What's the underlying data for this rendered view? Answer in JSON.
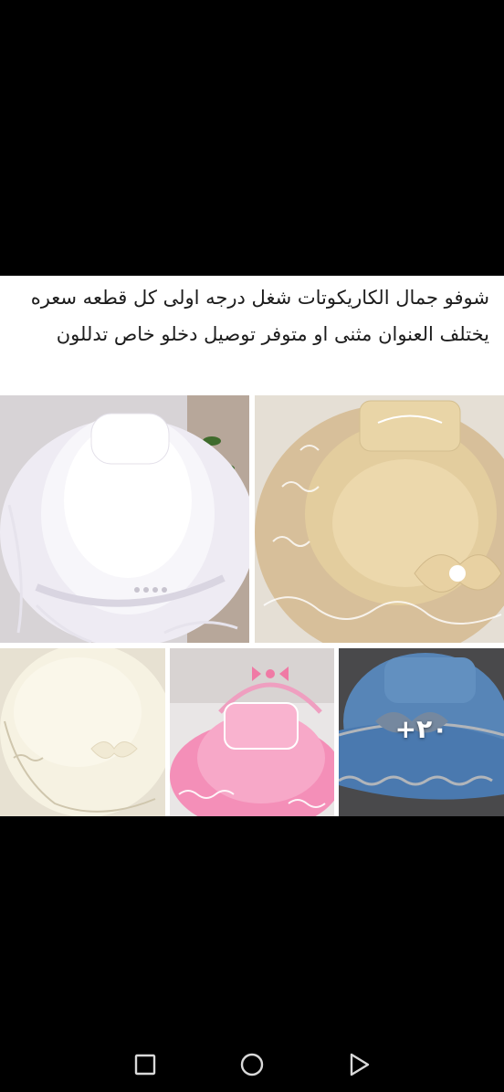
{
  "post": {
    "caption": "شوفو جمال الكاريكوتات شغل درجه اولى كل قطعه سعره يختلف العنوان مثنى او متوفر توصيل دخلو خاص تدللون",
    "more_photos_label": "+٢٠"
  },
  "photos": [
    {
      "icon": "white-baby-nest-photo"
    },
    {
      "icon": "beige-baby-nest-photo"
    },
    {
      "icon": "cream-baby-nest-photo"
    },
    {
      "icon": "pink-baby-nest-photo"
    },
    {
      "icon": "blue-baby-nest-photo"
    }
  ],
  "navigation": {
    "icons": [
      "recents-square-icon",
      "home-circle-icon",
      "back-triangle-icon"
    ],
    "color": "#d9d9d9"
  },
  "colors": {
    "background": "#000000",
    "post_background": "#ffffff",
    "text": "#1c1c1c"
  }
}
